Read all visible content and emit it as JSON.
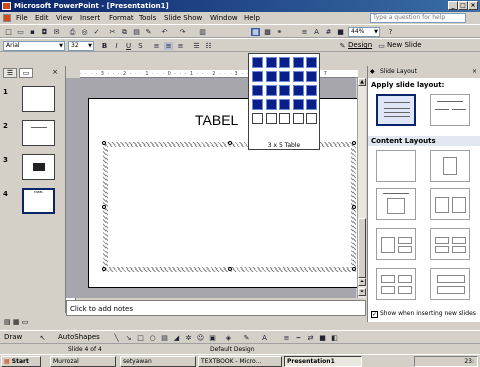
{
  "window": {
    "title": "Microsoft PowerPoint - [Presentation1]"
  },
  "menu": [
    "File",
    "Edit",
    "View",
    "Insert",
    "Format",
    "Tools",
    "Slide Show",
    "Window",
    "Help"
  ],
  "help_box": {
    "placeholder": "Type a question for help"
  },
  "formatting": {
    "font": "Arial",
    "size": "32",
    "zoom": "44%"
  },
  "buttons": {
    "design": "Design",
    "new_slide": "New Slide"
  },
  "table_picker": {
    "rows_selected": 3,
    "cols_selected": 5,
    "total_rows": 4,
    "total_cols": 5,
    "label": "3 x 5 Table"
  },
  "slides": [
    {
      "num": "1",
      "text": ""
    },
    {
      "num": "2",
      "text": ""
    },
    {
      "num": "3",
      "text": ""
    },
    {
      "num": "4",
      "text": "TABEL"
    }
  ],
  "slide": {
    "title": "TABEL"
  },
  "notes": {
    "placeholder": "Click to add notes"
  },
  "task_pane": {
    "title": "Slide Layout",
    "apply_label": "Apply slide layout:",
    "content_label": "Content Layouts",
    "show_checkbox": "Show when inserting new slides"
  },
  "draw_toolbar": {
    "draw": "Draw",
    "autoshapes": "AutoShapes"
  },
  "status": {
    "slide": "Slide 4 of 4",
    "design": "Default Design"
  },
  "taskbar": {
    "start": "Start",
    "items": [
      "Murrozal",
      "setyawan",
      "TEXTBOOK - Micro...",
      "Presentation1"
    ],
    "clock": "23:"
  }
}
